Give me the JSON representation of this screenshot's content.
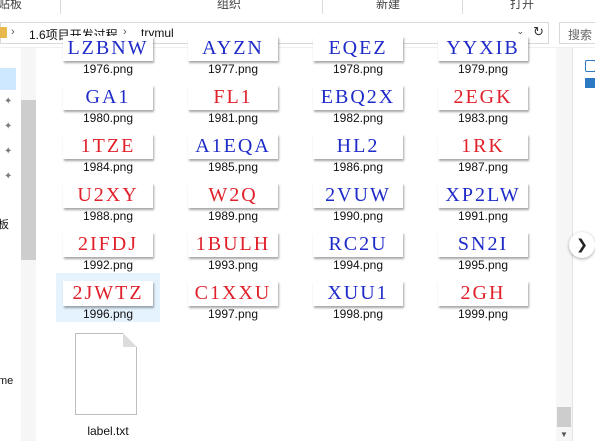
{
  "ribbon": {
    "groups": [
      "贴板",
      "组织",
      "新建",
      "打开"
    ]
  },
  "address": {
    "crumbs": [
      "1.6项目开发过程",
      "trymul"
    ],
    "search_placeholder": "搜索"
  },
  "nav": {
    "fragments": [
      "板",
      "me"
    ]
  },
  "files": [
    {
      "name": "1976.png",
      "text": "LZBNW",
      "color": "blue"
    },
    {
      "name": "1977.png",
      "text": "AYZN",
      "color": "blue"
    },
    {
      "name": "1978.png",
      "text": "EQEZ",
      "color": "blue"
    },
    {
      "name": "1979.png",
      "text": "YYXIB",
      "color": "blue"
    },
    {
      "name": "1980.png",
      "text": "GA1",
      "color": "blue"
    },
    {
      "name": "1981.png",
      "text": "FL1",
      "color": "red"
    },
    {
      "name": "1982.png",
      "text": "EBQ2X",
      "color": "blue"
    },
    {
      "name": "1983.png",
      "text": "2EGK",
      "color": "red"
    },
    {
      "name": "1984.png",
      "text": "1TZE",
      "color": "red"
    },
    {
      "name": "1985.png",
      "text": "A1EQA",
      "color": "blue"
    },
    {
      "name": "1986.png",
      "text": "HL2",
      "color": "blue"
    },
    {
      "name": "1987.png",
      "text": "1RK",
      "color": "red"
    },
    {
      "name": "1988.png",
      "text": "U2XY",
      "color": "red"
    },
    {
      "name": "1989.png",
      "text": "W2Q",
      "color": "red"
    },
    {
      "name": "1990.png",
      "text": "2VUW",
      "color": "blue"
    },
    {
      "name": "1991.png",
      "text": "XP2LW",
      "color": "blue"
    },
    {
      "name": "1992.png",
      "text": "2IFDJ",
      "color": "red"
    },
    {
      "name": "1993.png",
      "text": "1BULH",
      "color": "red"
    },
    {
      "name": "1994.png",
      "text": "RC2U",
      "color": "blue"
    },
    {
      "name": "1995.png",
      "text": "SN2I",
      "color": "blue"
    },
    {
      "name": "1996.png",
      "text": "2JWTZ",
      "color": "red"
    },
    {
      "name": "1997.png",
      "text": "C1XXU",
      "color": "red"
    },
    {
      "name": "1998.png",
      "text": "XUU1",
      "color": "blue"
    },
    {
      "name": "1999.png",
      "text": "2GH",
      "color": "red"
    }
  ],
  "selected_file": "1996.png",
  "doc_file": {
    "name": "label.txt"
  },
  "icons": {
    "folder": "folder-icon",
    "refresh": "refresh-icon",
    "dropdown": "chevron-down-icon",
    "next": "chevron-right-icon",
    "pin": "pin-icon"
  }
}
